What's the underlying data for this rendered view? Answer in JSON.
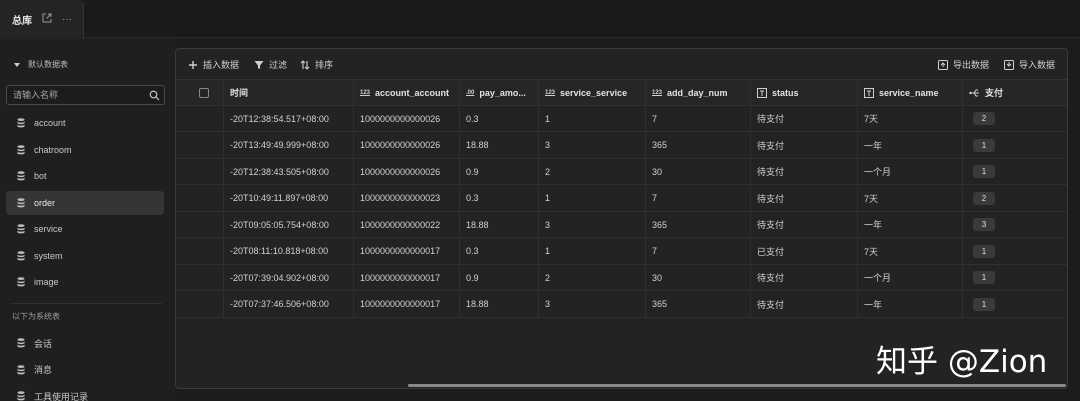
{
  "tab": {
    "title": "总库",
    "open_icon": "external-link-icon",
    "more_label": "···"
  },
  "sidebar": {
    "section_title": "默认数据表",
    "search_placeholder": "请输入名称",
    "tables": [
      {
        "label": "account",
        "active": false
      },
      {
        "label": "chatroom",
        "active": false
      },
      {
        "label": "bot",
        "active": false
      },
      {
        "label": "order",
        "active": true
      },
      {
        "label": "service",
        "active": false
      },
      {
        "label": "system",
        "active": false
      },
      {
        "label": "image",
        "active": false
      }
    ],
    "system_title": "以下为系统表",
    "system_tables": [
      {
        "label": "会话"
      },
      {
        "label": "消息"
      },
      {
        "label": "工具使用记录"
      }
    ]
  },
  "toolbar": {
    "insert_label": "插入数据",
    "filter_label": "过滤",
    "sort_label": "排序",
    "export_label": "导出数据",
    "import_label": "导入数据"
  },
  "table": {
    "columns": [
      {
        "label": "时间",
        "type_icon": ""
      },
      {
        "label": "account_account",
        "type_icon": "123"
      },
      {
        "label": "pay_amo...",
        "type_icon": ".00"
      },
      {
        "label": "service_service",
        "type_icon": "123"
      },
      {
        "label": "add_day_num",
        "type_icon": "123"
      },
      {
        "label": "status",
        "type_icon": "text-type-icon"
      },
      {
        "label": "service_name",
        "type_icon": "text-type-icon"
      },
      {
        "label": "支付",
        "type_icon": "usb-relation-icon"
      }
    ],
    "rows": [
      [
        "-20T12:38:54.517+08:00",
        "1000000000000026",
        "0.3",
        "1",
        "7",
        "待支付",
        "7天",
        "2"
      ],
      [
        "-20T13:49:49.999+08:00",
        "1000000000000026",
        "18.88",
        "3",
        "365",
        "待支付",
        "一年",
        "1"
      ],
      [
        "-20T12:38:43.505+08:00",
        "1000000000000026",
        "0.9",
        "2",
        "30",
        "待支付",
        "一个月",
        "1"
      ],
      [
        "-20T10:49:11.897+08:00",
        "1000000000000023",
        "0.3",
        "1",
        "7",
        "待支付",
        "7天",
        "2"
      ],
      [
        "-20T09:05:05.754+08:00",
        "1000000000000022",
        "18.88",
        "3",
        "365",
        "待支付",
        "一年",
        "3"
      ],
      [
        "-20T08:11:10.818+08:00",
        "1000000000000017",
        "0.3",
        "1",
        "7",
        "已支付",
        "7天",
        "1"
      ],
      [
        "-20T07:39:04.902+08:00",
        "1000000000000017",
        "0.9",
        "2",
        "30",
        "待支付",
        "一个月",
        "1"
      ],
      [
        "-20T07:37:46.506+08:00",
        "1000000000000017",
        "18.88",
        "3",
        "365",
        "待支付",
        "一年",
        "1"
      ]
    ]
  },
  "watermark": "知乎 @Zion",
  "colors": {
    "background": "#1c1c1c",
    "panel": "#232323",
    "active_item": "#353535",
    "badge": "#3a3a3a"
  }
}
